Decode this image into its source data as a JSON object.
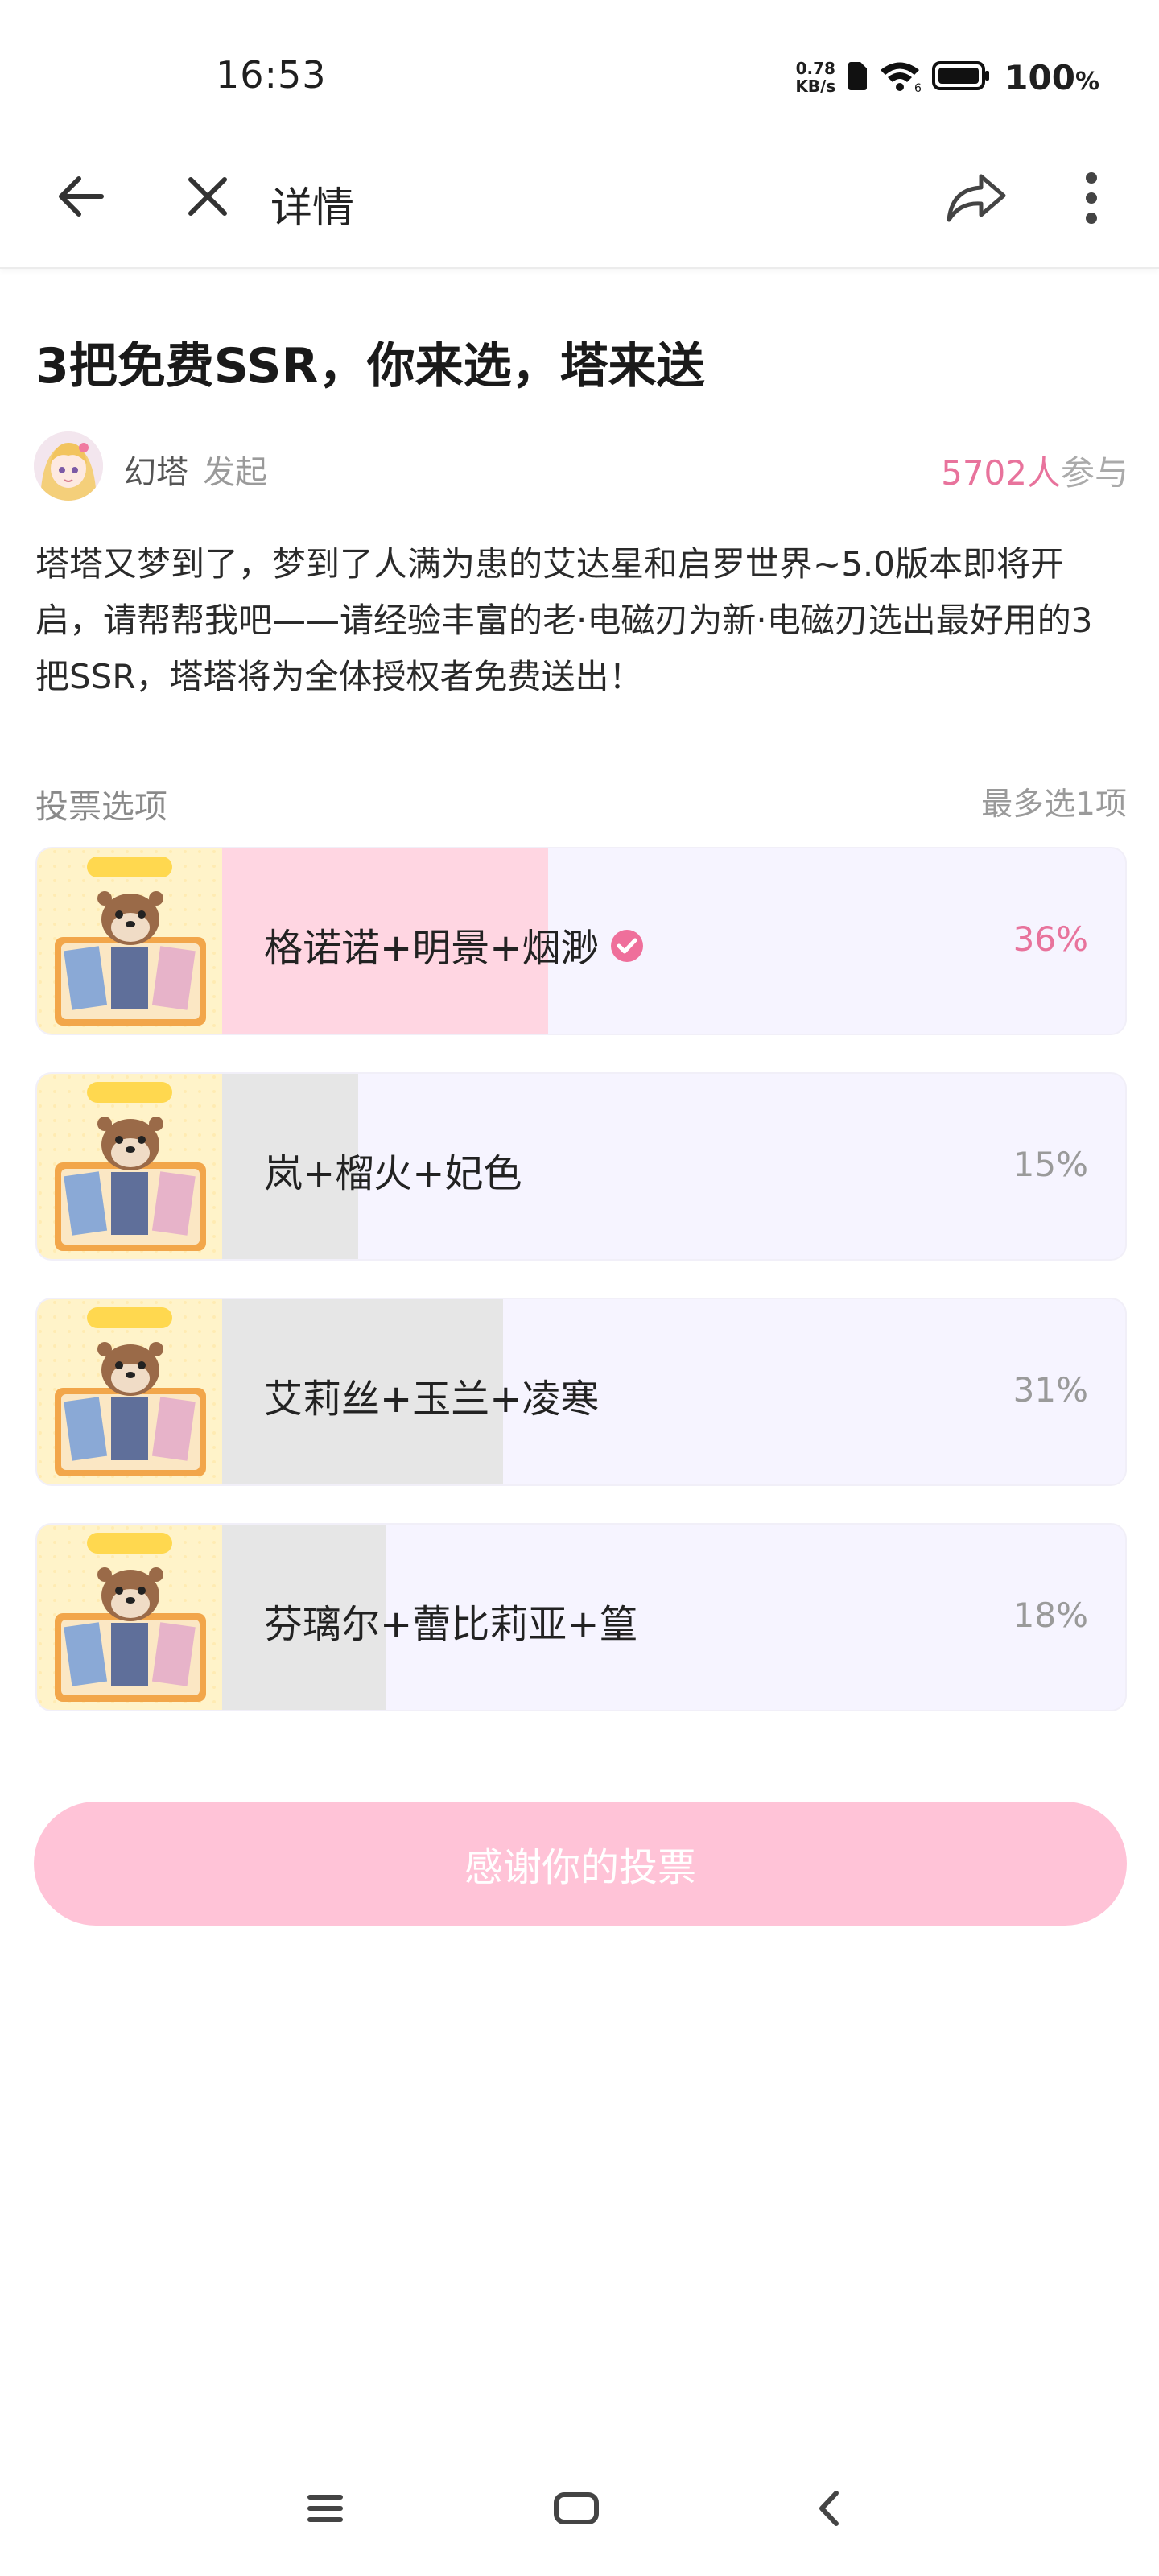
{
  "status": {
    "time": "16:53",
    "net_speed_value": "0.78",
    "net_speed_unit": "KB/s",
    "battery": "100",
    "battery_unit": "%"
  },
  "nav": {
    "title": "详情"
  },
  "post": {
    "title": "3把免费SSR，你来选，塔来送",
    "author": "幻塔",
    "author_action": "发起",
    "participants_count": "5702人",
    "participants_suffix": "参与",
    "description": "塔塔又梦到了，梦到了人满为患的艾达星和启罗世界~5.0版本即将开启，请帮帮我吧——请经验丰富的老·电磁刃为新·电磁刃选出最好用的3把SSR，塔塔将为全体授权者免费送出！"
  },
  "vote": {
    "section_label": "投票选项",
    "limit_label": "最多选1项",
    "options": [
      {
        "label": "格诺诺+明景+烟渺",
        "percent": "36%",
        "share": 0.36,
        "selected": true
      },
      {
        "label": "岚+榴火+妃色",
        "percent": "15%",
        "share": 0.15,
        "selected": false
      },
      {
        "label": "艾莉丝+玉兰+凌寒",
        "percent": "31%",
        "share": 0.31,
        "selected": false
      },
      {
        "label": "芬璃尔+蕾比莉亚+篁",
        "percent": "18%",
        "share": 0.18,
        "selected": false
      }
    ],
    "submit_label": "感谢你的投票"
  },
  "colors": {
    "accent": "#e8739c",
    "selected_bar": "#ffd6e2",
    "unselected_bar": "#e6e6e6",
    "option_bg": "#f6f4ff",
    "button": "#ffc3d7"
  }
}
